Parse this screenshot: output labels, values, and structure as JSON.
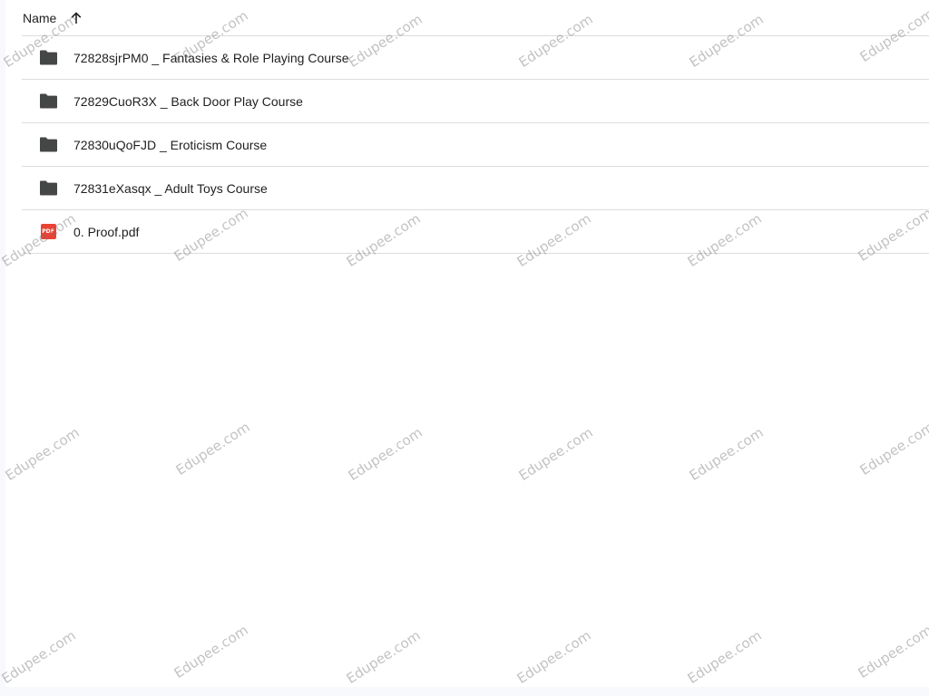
{
  "header": {
    "name_label": "Name",
    "sort_icon": "arrow-up-icon"
  },
  "files": [
    {
      "type": "folder",
      "icon": "folder-icon",
      "name": "72828sjrPM0 _ Fantasies & Role Playing Course"
    },
    {
      "type": "folder",
      "icon": "folder-icon",
      "name": "72829CuoR3X _ Back Door Play Course"
    },
    {
      "type": "folder",
      "icon": "folder-icon",
      "name": "72830uQoFJD _ Eroticism Course"
    },
    {
      "type": "folder",
      "icon": "folder-icon",
      "name": "72831eXasqx _ Adult Toys Course"
    },
    {
      "type": "pdf",
      "icon": "pdf-file-icon",
      "name": "0. Proof.pdf",
      "badge": "PDF"
    }
  ],
  "watermark": {
    "text": "Edupee.com"
  },
  "colors": {
    "folder": "#444746",
    "pdf": "#ea4335",
    "divider": "#dadce0",
    "text": "#1f1f1f"
  }
}
